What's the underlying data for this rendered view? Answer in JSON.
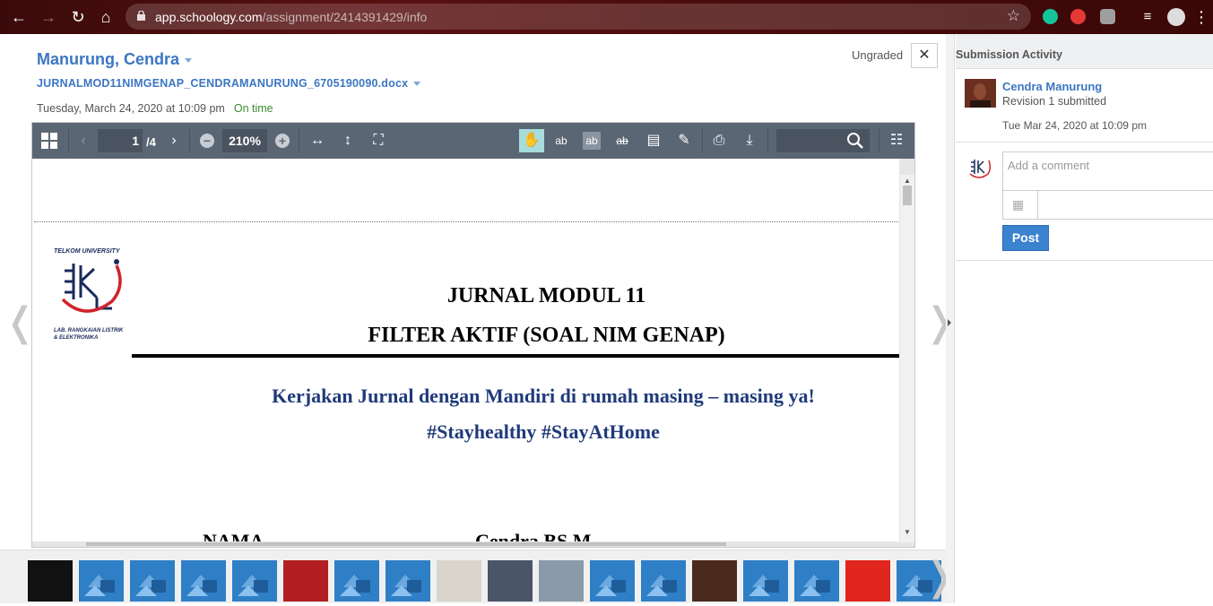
{
  "browser": {
    "url_host": "app.schoology.com",
    "url_path": "/assignment/2414391429/info"
  },
  "header": {
    "student_name": "Manurung, Cendra",
    "file_name": "JURNALMOD11NIMGENAP_CENDRAMANURUNG_6705190090.docx",
    "submitted_at": "Tuesday, March 24, 2020 at 10:09 pm",
    "status": "On time",
    "grade": "Ungraded",
    "close": "✕"
  },
  "viewer": {
    "current_page": "1",
    "page_total": "/4",
    "zoom": "210%"
  },
  "document": {
    "logo_top_text": "TELKOM UNIVERSITY",
    "logo_bottom_text": "LAB. RANGKAIAN LISTRIK & ELEKTRONIKA",
    "title1": "JURNAL MODUL 11",
    "title2": "FILTER AKTIF (SOAL NIM GENAP)",
    "subtitle1": "Kerjakan Jurnal dengan Mandiri di rumah masing – masing ya!",
    "subtitle2": "#Stayhealthy #StayAtHome",
    "name_label": "NAMA",
    "name_value": "Cendra BS M"
  },
  "panel": {
    "title": "Submission Activity",
    "activity_name": "Cendra Manurung",
    "activity_revision": "Revision 1 submitted",
    "activity_date": "Tue Mar 24, 2020 at 10:09 pm",
    "comment_placeholder": "Add a comment",
    "post_label": "Post"
  },
  "colors": {
    "link_blue": "#3b76c2",
    "on_time_green": "#3a8d2e",
    "toolbar_gray": "#5b6674",
    "doc_blue": "#1f3a7a",
    "post_blue": "#3b82cf"
  },
  "filmstrip": [
    {
      "kind": "photo",
      "color": "#111111"
    },
    {
      "kind": "doc"
    },
    {
      "kind": "doc"
    },
    {
      "kind": "doc"
    },
    {
      "kind": "doc"
    },
    {
      "kind": "photo",
      "color": "#b21e22"
    },
    {
      "kind": "doc"
    },
    {
      "kind": "doc"
    },
    {
      "kind": "photo",
      "color": "#d9d4cc"
    },
    {
      "kind": "photo",
      "color": "#4a5568"
    },
    {
      "kind": "photo",
      "color": "#8a9aa8"
    },
    {
      "kind": "doc"
    },
    {
      "kind": "doc"
    },
    {
      "kind": "photo",
      "color": "#4a2a1c"
    },
    {
      "kind": "doc"
    },
    {
      "kind": "doc"
    },
    {
      "kind": "photo",
      "color": "#e0261e"
    },
    {
      "kind": "doc"
    }
  ]
}
